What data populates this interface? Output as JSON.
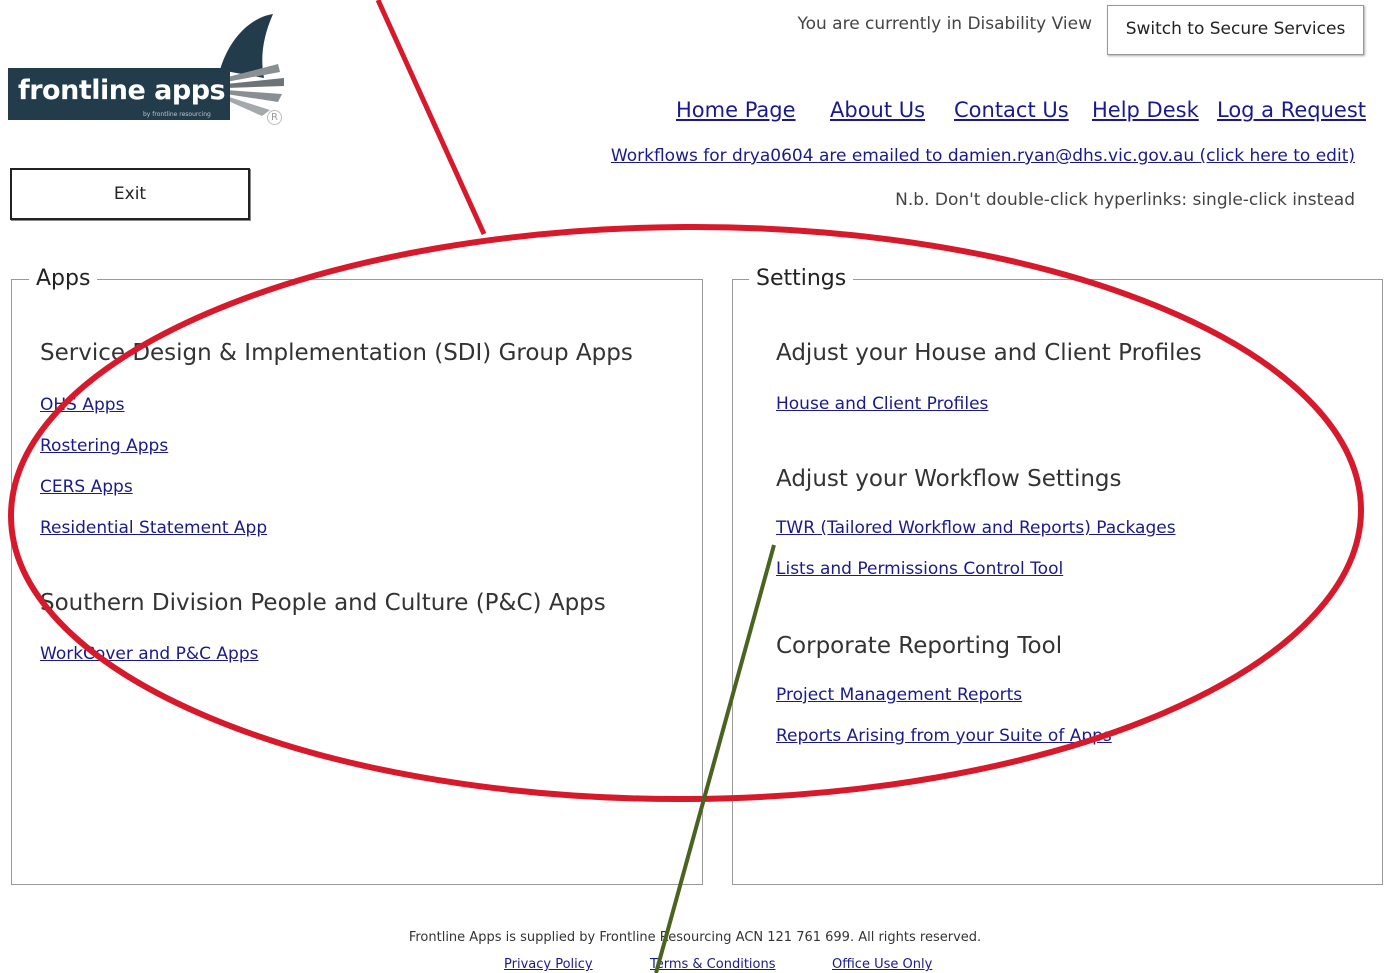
{
  "logo": {
    "name": "frontline apps",
    "tagline": "by frontline resourcing",
    "registered_mark": "R"
  },
  "exit_button": {
    "label": "Exit"
  },
  "header": {
    "view_text": "You are currently in Disability View",
    "switch_button": "Switch to Secure Services",
    "nav": [
      "Home Page",
      "About Us",
      "Contact Us",
      "Help Desk",
      "Log a Request"
    ],
    "workflow_link": "Workflows for drya0604 are emailed to damien.ryan@dhs.vic.gov.au (click here to edit)",
    "note": "N.b. Don't double-click hyperlinks: single-click instead"
  },
  "apps_panel": {
    "legend": "Apps",
    "groups": [
      {
        "heading": "Service Design & Implementation (SDI) Group Apps",
        "links": [
          "OHS Apps",
          "Rostering Apps",
          "CERS Apps",
          "Residential Statement App"
        ]
      },
      {
        "heading": "Southern Division People and Culture (P&C) Apps",
        "links": [
          "WorkCover and P&C Apps"
        ]
      }
    ]
  },
  "settings_panel": {
    "legend": "Settings",
    "groups": [
      {
        "heading": "Adjust your House and Client Profiles",
        "links": [
          "House and Client Profiles"
        ]
      },
      {
        "heading": "Adjust your Workflow Settings",
        "links": [
          "TWR (Tailored Workflow and Reports) Packages",
          "Lists and Permissions Control Tool"
        ]
      },
      {
        "heading": "Corporate Reporting Tool",
        "links": [
          "Project Management Reports",
          "Reports Arising from your Suite of Apps"
        ]
      }
    ]
  },
  "footer": {
    "text": "Frontline Apps is supplied by Frontline Resourcing ACN 121 761 699. All rights reserved.",
    "links": [
      "Privacy Policy",
      "Terms & Conditions",
      "Office Use Only"
    ]
  },
  "colors": {
    "logo_navy": "#233c4b",
    "link": "#1a1a8c",
    "annotation_red": "#d6192b",
    "annotation_green": "#4a6320"
  }
}
